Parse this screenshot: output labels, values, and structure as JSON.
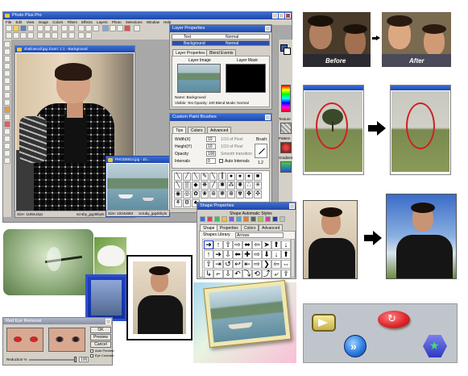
{
  "app": {
    "title": "Photo Plus Pro",
    "menu": [
      "File",
      "Edit",
      "View",
      "Image",
      "Colors",
      "Filters",
      "Effects",
      "Layers",
      "Photo",
      "Selections",
      "Window",
      "Help"
    ]
  },
  "doc_main": {
    "title": "shallowcall.jpg  Zoom: 1:1 - Background",
    "status_left": "Size: 1185x1kyx",
    "status_right": "scruby_jpg4kbyts"
  },
  "doc_small": {
    "title": "PHOD5914.jpg - Zo...",
    "status_left": "Size: 1024x683",
    "status_right": "scruby_jpg4kbyts"
  },
  "layers_panel": {
    "title": "Layer Properties",
    "rows": [
      {
        "name": "Text",
        "mode": "Normal"
      },
      {
        "name": "Background",
        "mode": "Normal"
      }
    ],
    "tabs": [
      "Layer Properties",
      "Blend Events"
    ],
    "image_label": "Layer Image",
    "mask_label": "Layer Mask",
    "info_name": "Name: Background",
    "info_props": "Visible: Yes   Opacity: 100   Blend Mode: Normal"
  },
  "brush_panel": {
    "title": "Custom Paint Brushes",
    "tabs": [
      "Tips",
      "Colors",
      "Advanced"
    ],
    "fields": [
      {
        "label": "Width(X)",
        "value": "10",
        "unit": "1/10 of Pixel"
      },
      {
        "label": "Height(Y)",
        "value": "10",
        "unit": "1/10 of Pixel"
      },
      {
        "label": "Opacity",
        "value": "100",
        "unit": "Smooth transition"
      },
      {
        "label": "Intervals",
        "value": "0",
        "unit": "Auto Intervals"
      }
    ],
    "brush_label": "Brush:",
    "brush_value": "1.2"
  },
  "shape_panel": {
    "title": "Shape Properties",
    "styles_label": "Shape Automatic Styles",
    "tabs": [
      "Shape",
      "Properties",
      "Colors",
      "Advanced"
    ],
    "library_label": "Shapes Library",
    "library_value": "Arrows",
    "shapes": [
      "➜",
      "↑",
      "⇧",
      "⇨",
      "⬌",
      "⇦",
      "➤",
      "⬆",
      "↓",
      "↑",
      "➜",
      "⇩",
      "⬅",
      "✚",
      "⇨",
      "⬇",
      "↓",
      "⬆",
      "⇧",
      "⇥",
      "↺",
      "↩",
      "⇤",
      "⇨",
      "❯",
      "⇦",
      "⇔",
      "↳",
      "⌐",
      "⇩",
      "↶",
      "⤵",
      "⟲",
      "⤴",
      "⤶",
      "⇪"
    ]
  },
  "right_panels": {
    "texture_label": "Texture",
    "pattern_label": "Pattern",
    "gradient_label": "Gradient"
  },
  "before_after": {
    "before": "Before",
    "after": "After"
  },
  "red_eye_dialog": {
    "title": "Red Eye Removal",
    "buttons": [
      "OK",
      "Preview",
      "Cancel",
      "Help"
    ],
    "checks": [
      "Auto Preview",
      "Eye Contrast"
    ],
    "reduction_label": "Reduction %",
    "reduction_value": "100"
  },
  "tree_panel_small": {
    "title": "PHOD5914.jpg - Zo...",
    "status": "Size: 1024x683"
  },
  "colors": {
    "titlebar": "#2456c0",
    "panel": "#d4d0c8",
    "button_panel_bg": "#c0c5cc",
    "yellow_button": "#e8d878",
    "blue_button": "#2d7de0",
    "red_button": "#e0282c",
    "hex_button": "#4a50d8"
  }
}
